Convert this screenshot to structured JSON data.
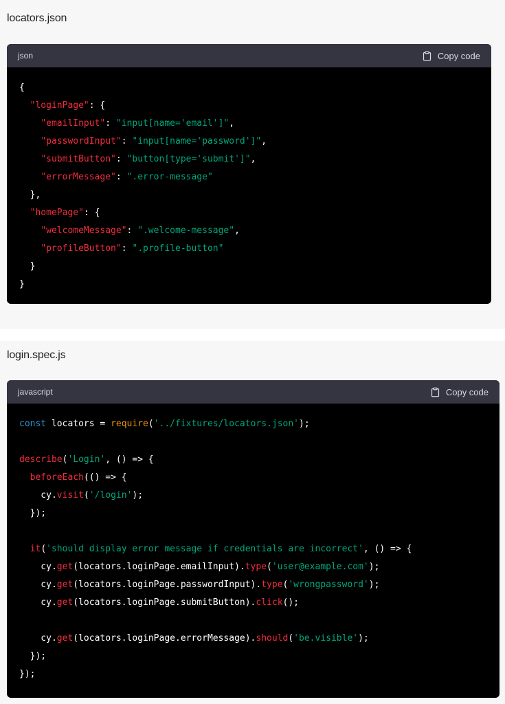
{
  "blocks": [
    {
      "filename": "locators.json",
      "lang": "json",
      "copy_label": "Copy code",
      "lines": [
        [
          {
            "t": "{",
            "c": "pl"
          }
        ],
        [
          {
            "t": "  ",
            "c": "pl"
          },
          {
            "t": "\"loginPage\"",
            "c": "key"
          },
          {
            "t": ": {",
            "c": "pl"
          }
        ],
        [
          {
            "t": "    ",
            "c": "pl"
          },
          {
            "t": "\"emailInput\"",
            "c": "key"
          },
          {
            "t": ": ",
            "c": "pl"
          },
          {
            "t": "\"input[name='email']\"",
            "c": "str"
          },
          {
            "t": ",",
            "c": "pl"
          }
        ],
        [
          {
            "t": "    ",
            "c": "pl"
          },
          {
            "t": "\"passwordInput\"",
            "c": "key"
          },
          {
            "t": ": ",
            "c": "pl"
          },
          {
            "t": "\"input[name='password']\"",
            "c": "str"
          },
          {
            "t": ",",
            "c": "pl"
          }
        ],
        [
          {
            "t": "    ",
            "c": "pl"
          },
          {
            "t": "\"submitButton\"",
            "c": "key"
          },
          {
            "t": ": ",
            "c": "pl"
          },
          {
            "t": "\"button[type='submit']\"",
            "c": "str"
          },
          {
            "t": ",",
            "c": "pl"
          }
        ],
        [
          {
            "t": "    ",
            "c": "pl"
          },
          {
            "t": "\"errorMessage\"",
            "c": "key"
          },
          {
            "t": ": ",
            "c": "pl"
          },
          {
            "t": "\".error-message\"",
            "c": "str"
          }
        ],
        [
          {
            "t": "  },",
            "c": "pl"
          }
        ],
        [
          {
            "t": "  ",
            "c": "pl"
          },
          {
            "t": "\"homePage\"",
            "c": "key"
          },
          {
            "t": ": {",
            "c": "pl"
          }
        ],
        [
          {
            "t": "    ",
            "c": "pl"
          },
          {
            "t": "\"welcomeMessage\"",
            "c": "key"
          },
          {
            "t": ": ",
            "c": "pl"
          },
          {
            "t": "\".welcome-message\"",
            "c": "str"
          },
          {
            "t": ",",
            "c": "pl"
          }
        ],
        [
          {
            "t": "    ",
            "c": "pl"
          },
          {
            "t": "\"profileButton\"",
            "c": "key"
          },
          {
            "t": ": ",
            "c": "pl"
          },
          {
            "t": "\".profile-button\"",
            "c": "str"
          }
        ],
        [
          {
            "t": "  }",
            "c": "pl"
          }
        ],
        [
          {
            "t": "}",
            "c": "pl"
          }
        ]
      ]
    },
    {
      "filename": "login.spec.js",
      "lang": "javascript",
      "copy_label": "Copy code",
      "lines": [
        [
          {
            "t": "const",
            "c": "kw"
          },
          {
            "t": " locators = ",
            "c": "pl"
          },
          {
            "t": "require",
            "c": "bi"
          },
          {
            "t": "(",
            "c": "pl"
          },
          {
            "t": "'../fixtures/locators.json'",
            "c": "str"
          },
          {
            "t": ");",
            "c": "pl"
          }
        ],
        [],
        [
          {
            "t": "describe",
            "c": "fn"
          },
          {
            "t": "(",
            "c": "pl"
          },
          {
            "t": "'Login'",
            "c": "str"
          },
          {
            "t": ", () => {",
            "c": "pl"
          }
        ],
        [
          {
            "t": "  ",
            "c": "pl"
          },
          {
            "t": "beforeEach",
            "c": "fn"
          },
          {
            "t": "(() => {",
            "c": "pl"
          }
        ],
        [
          {
            "t": "    cy.",
            "c": "pl"
          },
          {
            "t": "visit",
            "c": "fn"
          },
          {
            "t": "(",
            "c": "pl"
          },
          {
            "t": "'/login'",
            "c": "str"
          },
          {
            "t": ");",
            "c": "pl"
          }
        ],
        [
          {
            "t": "  });",
            "c": "pl"
          }
        ],
        [],
        [
          {
            "t": "  ",
            "c": "pl"
          },
          {
            "t": "it",
            "c": "fn"
          },
          {
            "t": "(",
            "c": "pl"
          },
          {
            "t": "'should display error message if credentials are incorrect'",
            "c": "str"
          },
          {
            "t": ", () => {",
            "c": "pl"
          }
        ],
        [
          {
            "t": "    cy.",
            "c": "pl"
          },
          {
            "t": "get",
            "c": "fn"
          },
          {
            "t": "(locators.loginPage.emailInput).",
            "c": "pl"
          },
          {
            "t": "type",
            "c": "fn"
          },
          {
            "t": "(",
            "c": "pl"
          },
          {
            "t": "'user@example.com'",
            "c": "str"
          },
          {
            "t": ");",
            "c": "pl"
          }
        ],
        [
          {
            "t": "    cy.",
            "c": "pl"
          },
          {
            "t": "get",
            "c": "fn"
          },
          {
            "t": "(locators.loginPage.passwordInput).",
            "c": "pl"
          },
          {
            "t": "type",
            "c": "fn"
          },
          {
            "t": "(",
            "c": "pl"
          },
          {
            "t": "'wrongpassword'",
            "c": "str"
          },
          {
            "t": ");",
            "c": "pl"
          }
        ],
        [
          {
            "t": "    cy.",
            "c": "pl"
          },
          {
            "t": "get",
            "c": "fn"
          },
          {
            "t": "(locators.loginPage.submitButton).",
            "c": "pl"
          },
          {
            "t": "click",
            "c": "fn"
          },
          {
            "t": "();",
            "c": "pl"
          }
        ],
        [],
        [
          {
            "t": "    cy.",
            "c": "pl"
          },
          {
            "t": "get",
            "c": "fn"
          },
          {
            "t": "(locators.loginPage.errorMessage).",
            "c": "pl"
          },
          {
            "t": "should",
            "c": "fn"
          },
          {
            "t": "(",
            "c": "pl"
          },
          {
            "t": "'be.visible'",
            "c": "str"
          },
          {
            "t": ");",
            "c": "pl"
          }
        ],
        [
          {
            "t": "  });",
            "c": "pl"
          }
        ],
        [
          {
            "t": "});",
            "c": "pl"
          }
        ]
      ]
    }
  ]
}
